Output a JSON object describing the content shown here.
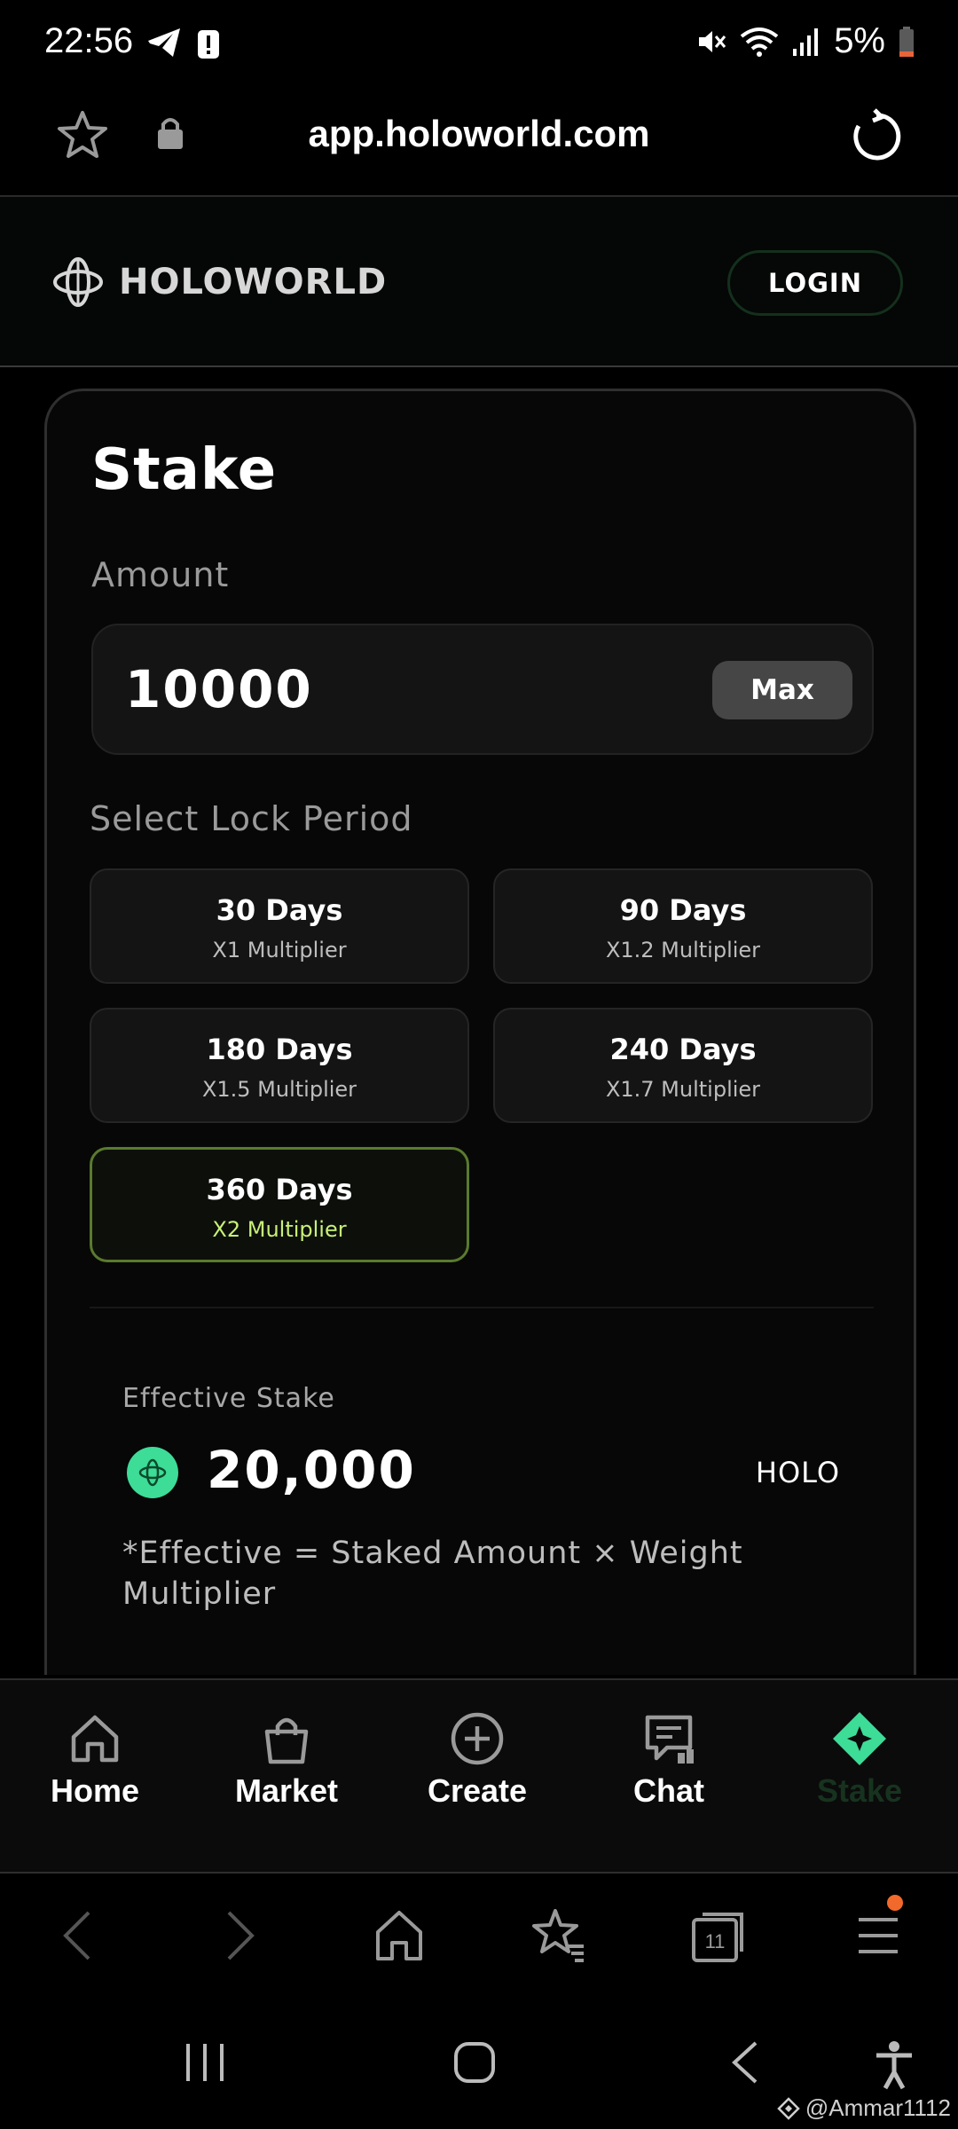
{
  "status_bar": {
    "time": "22:56",
    "battery": "5%",
    "icons": [
      "telegram-icon",
      "alert-icon",
      "mute-icon",
      "wifi-icon",
      "signal-icon",
      "battery-icon"
    ]
  },
  "browser": {
    "url": "app.holoworld.com",
    "toolbar_tabs_count": "11"
  },
  "header": {
    "brand": "HOLOWORLD",
    "login_label": "LOGIN"
  },
  "stake": {
    "title": "Stake",
    "amount_label": "Amount",
    "amount_value": "10000",
    "max_label": "Max",
    "lock_label": "Select Lock Period",
    "options": [
      {
        "days": "30 Days",
        "multiplier": "X1 Multiplier",
        "selected": false
      },
      {
        "days": "90 Days",
        "multiplier": "X1.2 Multiplier",
        "selected": false
      },
      {
        "days": "180 Days",
        "multiplier": "X1.5 Multiplier",
        "selected": false
      },
      {
        "days": "240 Days",
        "multiplier": "X1.7 Multiplier",
        "selected": false
      },
      {
        "days": "360 Days",
        "multiplier": "X2 Multiplier",
        "selected": true
      }
    ],
    "effective_label": "Effective Stake",
    "effective_value": "20,000",
    "effective_unit": "HOLO",
    "effective_note": "*Effective = Staked Amount × Weight Multiplier"
  },
  "app_nav": {
    "items": [
      {
        "label": "Home",
        "icon": "home-icon"
      },
      {
        "label": "Market",
        "icon": "bag-icon"
      },
      {
        "label": "Create",
        "icon": "plus-circle-icon"
      },
      {
        "label": "Chat",
        "icon": "chat-icon"
      },
      {
        "label": "Stake",
        "icon": "stake-diamond-icon",
        "active": true
      }
    ]
  },
  "colors": {
    "background": "#000000",
    "card": "#070707",
    "accent_green": "#3ddc97",
    "selected_border": "#5a7a2e",
    "selected_text": "#c8f07a"
  },
  "watermark": "@Ammar1112"
}
